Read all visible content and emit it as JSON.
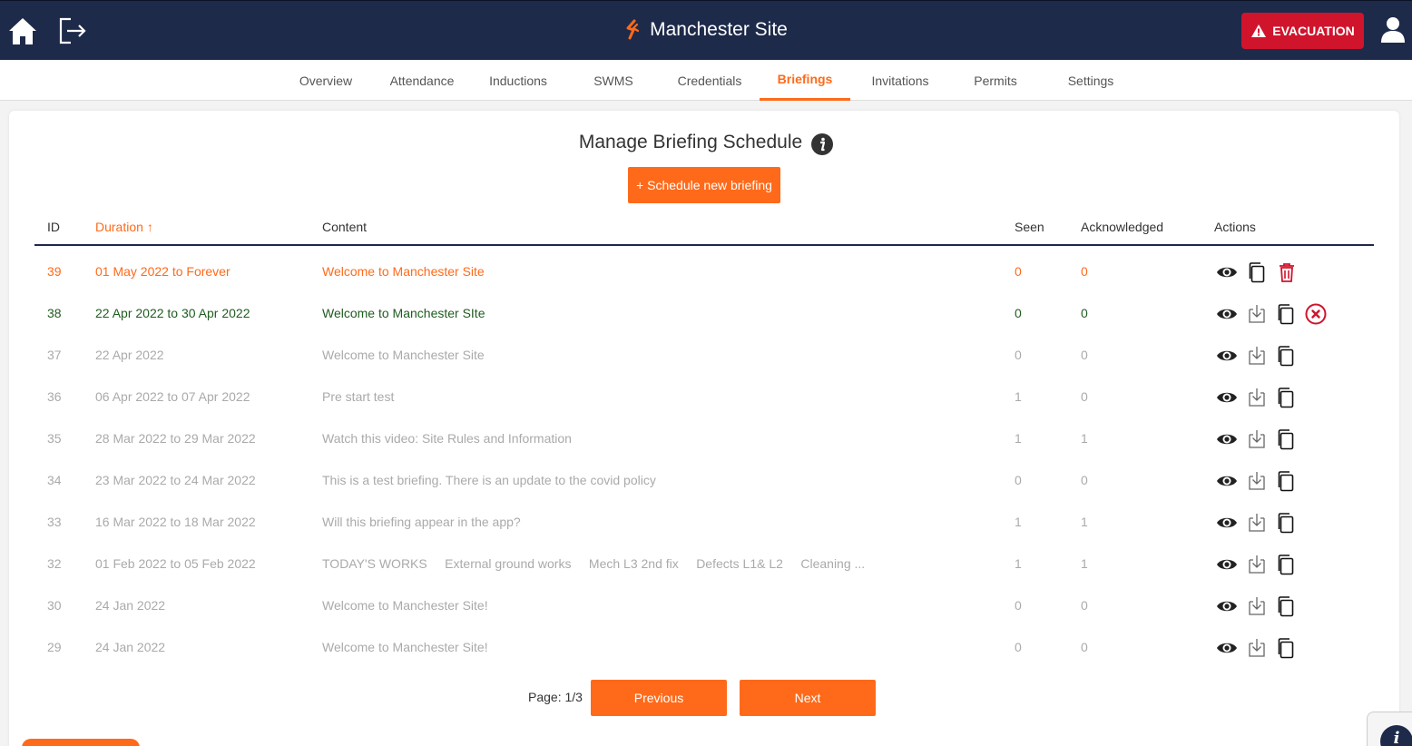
{
  "header": {
    "site_name": "Manchester Site",
    "evacuation_label": "EVACUATION",
    "colors": {
      "bar": "#1e2a4a",
      "accent": "#ff6a1a",
      "evacuation": "#d0142c"
    }
  },
  "tabs": [
    {
      "label": "Overview"
    },
    {
      "label": "Attendance"
    },
    {
      "label": "Inductions"
    },
    {
      "label": "SWMS"
    },
    {
      "label": "Credentials"
    },
    {
      "label": "Briefings",
      "active": true
    },
    {
      "label": "Invitations"
    },
    {
      "label": "Permits"
    },
    {
      "label": "Settings"
    }
  ],
  "page": {
    "title": "Manage Briefing Schedule",
    "schedule_button": "+ Schedule new briefing"
  },
  "table": {
    "columns": {
      "id": "ID",
      "duration": "Duration",
      "content": "Content",
      "seen": "Seen",
      "acknowledged": "Acknowledged",
      "actions": "Actions"
    },
    "sort_indicator": "↑",
    "rows": [
      {
        "id": "39",
        "duration": "01 May 2022 to Forever",
        "content": "Welcome to Manchester Site",
        "seen": "0",
        "acknowledged": "0",
        "status": "orange"
      },
      {
        "id": "38",
        "duration": "22 Apr 2022 to 30 Apr 2022",
        "content": "Welcome to Manchester SIte",
        "seen": "0",
        "acknowledged": "0",
        "status": "green"
      },
      {
        "id": "37",
        "duration": "22 Apr 2022",
        "content": "Welcome to Manchester Site",
        "seen": "0",
        "acknowledged": "0",
        "status": "grey"
      },
      {
        "id": "36",
        "duration": "06 Apr 2022 to 07 Apr 2022",
        "content": "Pre start test",
        "seen": "1",
        "acknowledged": "0",
        "status": "grey"
      },
      {
        "id": "35",
        "duration": "28 Mar 2022 to 29 Mar 2022",
        "content": "Watch this video: Site Rules and Information",
        "seen": "1",
        "acknowledged": "1",
        "status": "grey"
      },
      {
        "id": "34",
        "duration": "23 Mar 2022 to 24 Mar 2022",
        "content": "This is a test briefing. There is an update to the covid policy",
        "seen": "0",
        "acknowledged": "0",
        "status": "grey"
      },
      {
        "id": "33",
        "duration": "16 Mar 2022 to 18 Mar 2022",
        "content": "Will this briefing appear in the app?",
        "seen": "1",
        "acknowledged": "1",
        "status": "grey"
      },
      {
        "id": "32",
        "duration": "01 Feb 2022 to 05 Feb 2022",
        "content": "TODAY'S WORKS     External ground works     Mech L3 2nd fix     Defects L1& L2     Cleaning ...",
        "seen": "1",
        "acknowledged": "1",
        "status": "grey"
      },
      {
        "id": "30",
        "duration": "24 Jan 2022",
        "content": "Welcome to Manchester Site!",
        "seen": "0",
        "acknowledged": "0",
        "status": "grey"
      },
      {
        "id": "29",
        "duration": "24 Jan 2022",
        "content": "Welcome to Manchester Site!",
        "seen": "0",
        "acknowledged": "0",
        "status": "grey"
      }
    ]
  },
  "pagination": {
    "label": "Page: 1/3",
    "previous": "Previous",
    "next": "Next"
  }
}
